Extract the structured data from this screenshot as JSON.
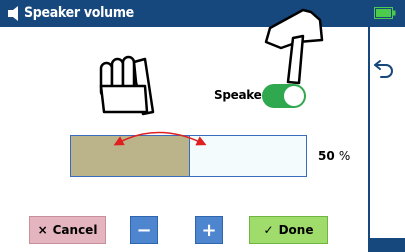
{
  "window": {
    "title": "Speaker volume"
  },
  "speaker": {
    "label": "Speaker",
    "enabled": true
  },
  "volume": {
    "value": 0.5,
    "value_text": "50",
    "unit": "%"
  },
  "buttons": {
    "cancel": {
      "icon": "x-icon",
      "glyph": "×",
      "label": "Cancel"
    },
    "minus": {
      "label": "−"
    },
    "plus": {
      "label": "+"
    },
    "done": {
      "icon": "check-icon",
      "glyph": "✓",
      "label": "Done"
    }
  },
  "colors": {
    "titlebar": "#17487d",
    "toggle_on": "#2fa84f",
    "volume_fill": "#bbb38a",
    "cancel": "#e4b5bf",
    "stepper": "#4d86cf",
    "done": "#9fdc6b",
    "annotation_arrow": "#e02020"
  },
  "annotations": [
    "pointing-hand-icon",
    "pointing-hand-icon",
    "double-arrow-icon"
  ]
}
